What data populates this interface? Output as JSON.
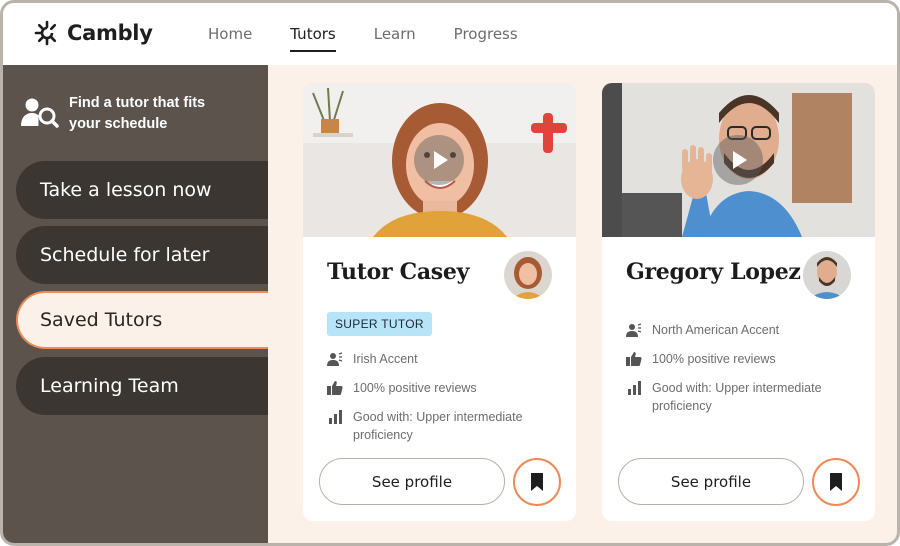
{
  "brand": {
    "name": "Cambly"
  },
  "nav": {
    "items": [
      "Home",
      "Tutors",
      "Learn",
      "Progress"
    ],
    "active": "Tutors"
  },
  "sidebar": {
    "find_text": "Find a tutor that fits your schedule",
    "buttons": [
      "Take a lesson now",
      "Schedule for later",
      "Saved Tutors",
      "Learning Team"
    ],
    "selected": "Saved Tutors"
  },
  "tutors": [
    {
      "name": "Tutor Casey",
      "badge": "SUPER TUTOR",
      "accent": "Irish Accent",
      "reviews": "100% positive reviews",
      "good_with": "Good with: Upper intermediate proficiency",
      "see_profile": "See profile"
    },
    {
      "name": "Gregory Lopez",
      "badge": "",
      "accent": "North American Accent",
      "reviews": "100% positive reviews",
      "good_with": "Good with: Upper intermediate proficiency",
      "see_profile": "See profile"
    }
  ],
  "icons": {
    "brand": "cambly-logo-icon",
    "find": "find-tutor-icon",
    "accent": "person-speech-icon",
    "reviews": "thumbs-up-icon",
    "level": "bar-chart-icon",
    "save": "bookmark-icon",
    "play": "play-icon"
  },
  "colors": {
    "sidebar_bg": "#5b534c",
    "sidebar_button_bg": "#3c3632",
    "page_bg": "#fbf1e8",
    "accent_orange": "#ee8a55",
    "badge_bg": "#b7e4f7"
  }
}
